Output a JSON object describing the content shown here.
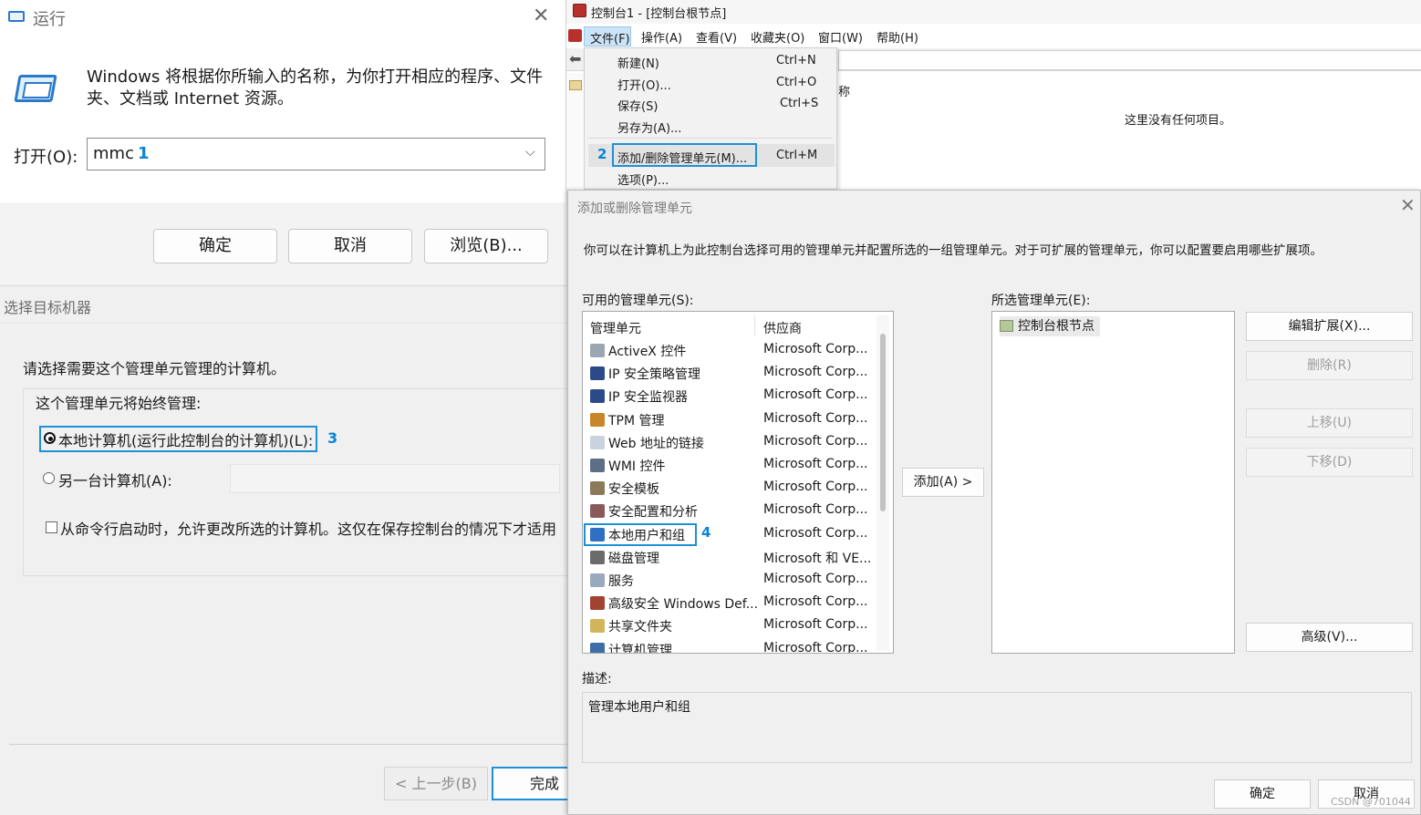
{
  "run": {
    "title": "运行",
    "description": "Windows 将根据你所输入的名称，为你打开相应的程序、文件夹、文档或 Internet 资源。",
    "open_label": "打开(O):",
    "input_value": "mmc",
    "step_marker": "1",
    "ok": "确定",
    "cancel": "取消",
    "browse": "浏览(B)...",
    "close_glyph": "✕"
  },
  "target": {
    "title": "选择目标机器",
    "prompt": "请选择需要这个管理单元管理的计算机。",
    "group_legend": "这个管理单元将始终管理:",
    "option_local": "本地计算机(运行此控制台的计算机)(L):",
    "option_local_selected": true,
    "step_marker": "3",
    "option_other": "另一台计算机(A):",
    "checkbox_text": "从命令行启动时，允许更改所选的计算机。这仅在保存控制台的情况下才适用",
    "back": "< 上一步(B)",
    "finish": "完成"
  },
  "mmc": {
    "title": "控制台1 - [控制台根节点]",
    "menus": [
      "文件(F)",
      "操作(A)",
      "查看(V)",
      "收藏夹(O)",
      "窗口(W)",
      "帮助(H)"
    ],
    "column_name": "称",
    "empty_text": "这里没有任何项目。",
    "file_menu": [
      {
        "label": "新建(N)",
        "key": "Ctrl+N"
      },
      {
        "label": "打开(O)...",
        "key": "Ctrl+O"
      },
      {
        "label": "保存(S)",
        "key": "Ctrl+S"
      },
      {
        "label": "另存为(A)...",
        "key": ""
      },
      {
        "label": "添加/删除管理单元(M)...",
        "key": "Ctrl+M"
      },
      {
        "label": "选项(P)...",
        "key": ""
      }
    ],
    "step_marker": "2"
  },
  "snapin": {
    "title": "添加或删除管理单元",
    "close_glyph": "✕",
    "description": "你可以在计算机上为此控制台选择可用的管理单元并配置所选的一组管理单元。对于可扩展的管理单元，你可以配置要启用哪些扩展项。",
    "available_label": "可用的管理单元(S):",
    "selected_label": "所选管理单元(E):",
    "col_snapin": "管理单元",
    "col_vendor": "供应商",
    "items": [
      {
        "name": "ActiveX 控件",
        "vendor": "Microsoft Corp...",
        "icon": "activex-icon",
        "color": "#9aa6b2"
      },
      {
        "name": "IP 安全策略管理",
        "vendor": "Microsoft Corp...",
        "icon": "ip-security-policy-icon",
        "color": "#2c4a8a"
      },
      {
        "name": "IP 安全监视器",
        "vendor": "Microsoft Corp...",
        "icon": "ip-security-monitor-icon",
        "color": "#2c4a8a"
      },
      {
        "name": "TPM 管理",
        "vendor": "Microsoft Corp...",
        "icon": "tpm-icon",
        "color": "#c8862b"
      },
      {
        "name": "Web 地址的链接",
        "vendor": "Microsoft Corp...",
        "icon": "web-link-icon",
        "color": "#c9d3df"
      },
      {
        "name": "WMI 控件",
        "vendor": "Microsoft Corp...",
        "icon": "wmi-icon",
        "color": "#5d6f86"
      },
      {
        "name": "安全模板",
        "vendor": "Microsoft Corp...",
        "icon": "security-template-icon",
        "color": "#8a7a5a"
      },
      {
        "name": "安全配置和分析",
        "vendor": "Microsoft Corp...",
        "icon": "security-config-icon",
        "color": "#8a5a5a"
      },
      {
        "name": "本地用户和组",
        "vendor": "Microsoft Corp...",
        "icon": "local-users-groups-icon",
        "color": "#2f6fc4"
      },
      {
        "name": "磁盘管理",
        "vendor": "Microsoft 和 VE...",
        "icon": "disk-management-icon",
        "color": "#6b6b6b"
      },
      {
        "name": "服务",
        "vendor": "Microsoft Corp...",
        "icon": "services-icon",
        "color": "#9aa9bb"
      },
      {
        "name": "高级安全 Windows Def...",
        "vendor": "Microsoft Corp...",
        "icon": "firewall-icon",
        "color": "#a0432f"
      },
      {
        "name": "共享文件夹",
        "vendor": "Microsoft Corp...",
        "icon": "shared-folders-icon",
        "color": "#d2b55a"
      },
      {
        "name": "计算机管理",
        "vendor": "Microsoft Corp...",
        "icon": "computer-management-icon",
        "color": "#3d6ea8"
      }
    ],
    "step_marker": "4",
    "add_button": "添加(A) >",
    "selected_item": "控制台根节点",
    "edit_ext": "编辑扩展(X)...",
    "delete": "删除(R)",
    "move_up": "上移(U)",
    "move_down": "下移(D)",
    "advanced": "高级(V)...",
    "desc_label": "描述:",
    "desc_text": "管理本地用户和组",
    "ok": "确定",
    "cancel": "取消",
    "watermark": "CSDN @701044"
  }
}
